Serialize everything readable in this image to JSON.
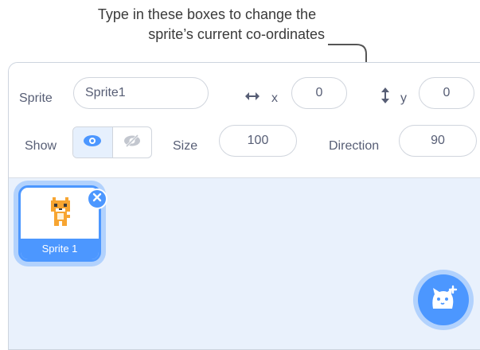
{
  "caption": {
    "line1": "Type in these boxes to change the",
    "line2": "sprite’s current co-ordinates"
  },
  "sprite_info": {
    "sprite_label": "Sprite",
    "sprite_name": "Sprite1",
    "x_label": "x",
    "x_value": "0",
    "y_label": "y",
    "y_value": "0",
    "show_label": "Show",
    "size_label": "Size",
    "size_value": "100",
    "direction_label": "Direction",
    "direction_value": "90"
  },
  "sprites": [
    {
      "name": "Sprite 1",
      "selected": true
    }
  ],
  "icons": {
    "x_axis": "horizontal-arrows-icon",
    "y_axis": "vertical-arrows-icon",
    "show": "eye-icon",
    "hide": "eye-slash-icon",
    "delete": "close-icon",
    "add_sprite": "cat-plus-icon"
  },
  "colors": {
    "accent": "#4c97ff",
    "panel_bg": "#e9f1fc",
    "text": "#575e75"
  }
}
